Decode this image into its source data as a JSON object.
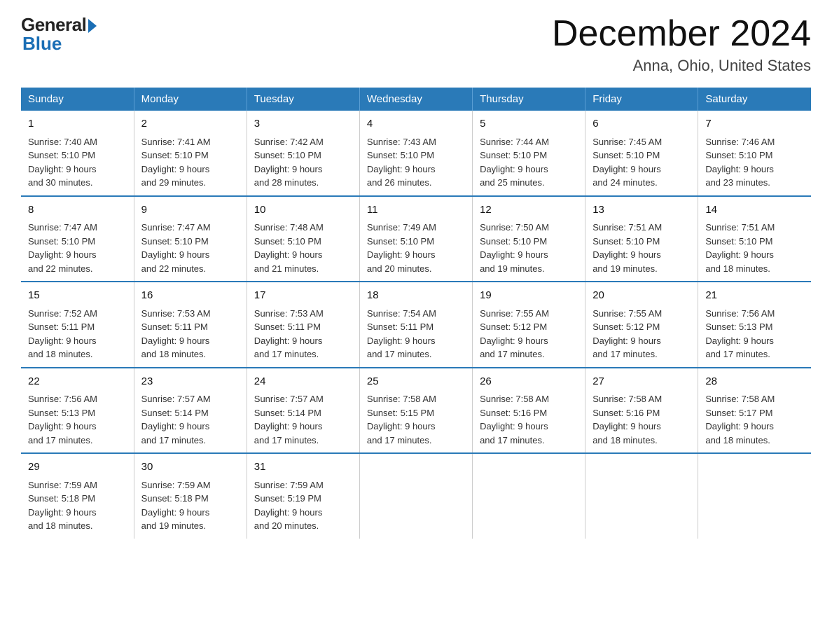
{
  "logo": {
    "general": "General",
    "blue": "Blue"
  },
  "title": {
    "month": "December 2024",
    "location": "Anna, Ohio, United States"
  },
  "weekdays": [
    "Sunday",
    "Monday",
    "Tuesday",
    "Wednesday",
    "Thursday",
    "Friday",
    "Saturday"
  ],
  "weeks": [
    [
      {
        "day": "1",
        "sunrise": "7:40 AM",
        "sunset": "5:10 PM",
        "daylight": "9 hours and 30 minutes."
      },
      {
        "day": "2",
        "sunrise": "7:41 AM",
        "sunset": "5:10 PM",
        "daylight": "9 hours and 29 minutes."
      },
      {
        "day": "3",
        "sunrise": "7:42 AM",
        "sunset": "5:10 PM",
        "daylight": "9 hours and 28 minutes."
      },
      {
        "day": "4",
        "sunrise": "7:43 AM",
        "sunset": "5:10 PM",
        "daylight": "9 hours and 26 minutes."
      },
      {
        "day": "5",
        "sunrise": "7:44 AM",
        "sunset": "5:10 PM",
        "daylight": "9 hours and 25 minutes."
      },
      {
        "day": "6",
        "sunrise": "7:45 AM",
        "sunset": "5:10 PM",
        "daylight": "9 hours and 24 minutes."
      },
      {
        "day": "7",
        "sunrise": "7:46 AM",
        "sunset": "5:10 PM",
        "daylight": "9 hours and 23 minutes."
      }
    ],
    [
      {
        "day": "8",
        "sunrise": "7:47 AM",
        "sunset": "5:10 PM",
        "daylight": "9 hours and 22 minutes."
      },
      {
        "day": "9",
        "sunrise": "7:47 AM",
        "sunset": "5:10 PM",
        "daylight": "9 hours and 22 minutes."
      },
      {
        "day": "10",
        "sunrise": "7:48 AM",
        "sunset": "5:10 PM",
        "daylight": "9 hours and 21 minutes."
      },
      {
        "day": "11",
        "sunrise": "7:49 AM",
        "sunset": "5:10 PM",
        "daylight": "9 hours and 20 minutes."
      },
      {
        "day": "12",
        "sunrise": "7:50 AM",
        "sunset": "5:10 PM",
        "daylight": "9 hours and 19 minutes."
      },
      {
        "day": "13",
        "sunrise": "7:51 AM",
        "sunset": "5:10 PM",
        "daylight": "9 hours and 19 minutes."
      },
      {
        "day": "14",
        "sunrise": "7:51 AM",
        "sunset": "5:10 PM",
        "daylight": "9 hours and 18 minutes."
      }
    ],
    [
      {
        "day": "15",
        "sunrise": "7:52 AM",
        "sunset": "5:11 PM",
        "daylight": "9 hours and 18 minutes."
      },
      {
        "day": "16",
        "sunrise": "7:53 AM",
        "sunset": "5:11 PM",
        "daylight": "9 hours and 18 minutes."
      },
      {
        "day": "17",
        "sunrise": "7:53 AM",
        "sunset": "5:11 PM",
        "daylight": "9 hours and 17 minutes."
      },
      {
        "day": "18",
        "sunrise": "7:54 AM",
        "sunset": "5:11 PM",
        "daylight": "9 hours and 17 minutes."
      },
      {
        "day": "19",
        "sunrise": "7:55 AM",
        "sunset": "5:12 PM",
        "daylight": "9 hours and 17 minutes."
      },
      {
        "day": "20",
        "sunrise": "7:55 AM",
        "sunset": "5:12 PM",
        "daylight": "9 hours and 17 minutes."
      },
      {
        "day": "21",
        "sunrise": "7:56 AM",
        "sunset": "5:13 PM",
        "daylight": "9 hours and 17 minutes."
      }
    ],
    [
      {
        "day": "22",
        "sunrise": "7:56 AM",
        "sunset": "5:13 PM",
        "daylight": "9 hours and 17 minutes."
      },
      {
        "day": "23",
        "sunrise": "7:57 AM",
        "sunset": "5:14 PM",
        "daylight": "9 hours and 17 minutes."
      },
      {
        "day": "24",
        "sunrise": "7:57 AM",
        "sunset": "5:14 PM",
        "daylight": "9 hours and 17 minutes."
      },
      {
        "day": "25",
        "sunrise": "7:58 AM",
        "sunset": "5:15 PM",
        "daylight": "9 hours and 17 minutes."
      },
      {
        "day": "26",
        "sunrise": "7:58 AM",
        "sunset": "5:16 PM",
        "daylight": "9 hours and 17 minutes."
      },
      {
        "day": "27",
        "sunrise": "7:58 AM",
        "sunset": "5:16 PM",
        "daylight": "9 hours and 18 minutes."
      },
      {
        "day": "28",
        "sunrise": "7:58 AM",
        "sunset": "5:17 PM",
        "daylight": "9 hours and 18 minutes."
      }
    ],
    [
      {
        "day": "29",
        "sunrise": "7:59 AM",
        "sunset": "5:18 PM",
        "daylight": "9 hours and 18 minutes."
      },
      {
        "day": "30",
        "sunrise": "7:59 AM",
        "sunset": "5:18 PM",
        "daylight": "9 hours and 19 minutes."
      },
      {
        "day": "31",
        "sunrise": "7:59 AM",
        "sunset": "5:19 PM",
        "daylight": "9 hours and 20 minutes."
      },
      null,
      null,
      null,
      null
    ]
  ],
  "labels": {
    "sunrise": "Sunrise:",
    "sunset": "Sunset:",
    "daylight": "Daylight:"
  }
}
